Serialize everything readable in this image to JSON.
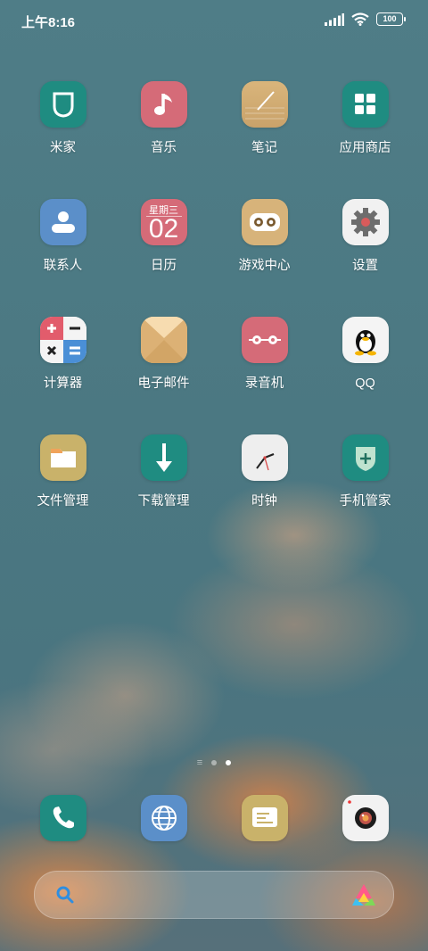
{
  "status_bar": {
    "time": "上午8:16",
    "battery": "100"
  },
  "apps": [
    {
      "label": "米家",
      "icon": "mijia-shield-icon"
    },
    {
      "label": "音乐",
      "icon": "music-note-icon"
    },
    {
      "label": "笔记",
      "icon": "notes-pen-icon"
    },
    {
      "label": "应用商店",
      "icon": "app-store-grid-icon"
    },
    {
      "label": "联系人",
      "icon": "contacts-person-icon"
    },
    {
      "label": "日历",
      "icon": "calendar-icon",
      "weekday": "星期三",
      "day": "02"
    },
    {
      "label": "游戏中心",
      "icon": "gamepad-icon"
    },
    {
      "label": "设置",
      "icon": "gear-icon"
    },
    {
      "label": "计算器",
      "icon": "calculator-icon"
    },
    {
      "label": "电子邮件",
      "icon": "envelope-icon"
    },
    {
      "label": "录音机",
      "icon": "recorder-tape-icon"
    },
    {
      "label": "QQ",
      "icon": "qq-penguin-icon"
    },
    {
      "label": "文件管理",
      "icon": "folder-icon"
    },
    {
      "label": "下载管理",
      "icon": "download-arrow-icon"
    },
    {
      "label": "时钟",
      "icon": "clock-icon"
    },
    {
      "label": "手机管家",
      "icon": "security-shield-icon"
    }
  ],
  "page_indicator": {
    "pages": 2,
    "current": 2
  },
  "dock": [
    {
      "icon": "phone-icon"
    },
    {
      "icon": "browser-globe-icon"
    },
    {
      "icon": "messages-icon"
    },
    {
      "icon": "camera-icon"
    }
  ],
  "colors": {
    "teal": "#1f8c81",
    "rose": "#d56b78",
    "tan": "#d7b37a",
    "blue": "#5b8fc9",
    "khaki": "#c9b26a"
  }
}
